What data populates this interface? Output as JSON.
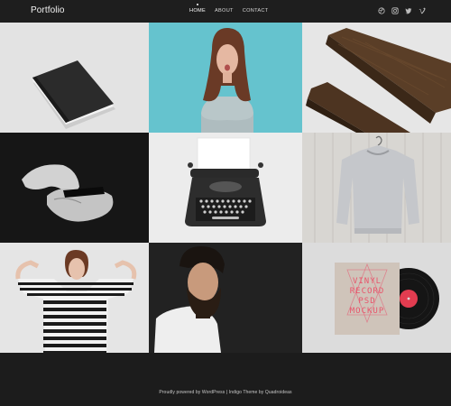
{
  "site": {
    "title": "Portfolio"
  },
  "nav": {
    "items": [
      {
        "label": "HOME",
        "active": true
      },
      {
        "label": "ABOUT",
        "active": false
      },
      {
        "label": "CONTACT",
        "active": false
      }
    ]
  },
  "social": {
    "icons": [
      "dribbble-icon",
      "instagram-icon",
      "twitter-icon",
      "vimeo-icon"
    ]
  },
  "portfolio": {
    "items": [
      {
        "name": "black-notebook",
        "background": "#e3e3e3"
      },
      {
        "name": "woman-on-blue",
        "background": "#65c3ce"
      },
      {
        "name": "wood-boards",
        "background": "#e6e6e6"
      },
      {
        "name": "hands-phone",
        "background": "#161616"
      },
      {
        "name": "typewriter",
        "background": "#ececec"
      },
      {
        "name": "grey-sweater",
        "background": "#d8d6d2"
      },
      {
        "name": "woman-striped-shirt",
        "background": "#e5e5e5"
      },
      {
        "name": "bearded-man",
        "background": "#222222"
      },
      {
        "name": "vinyl-record-mockup",
        "background": "#dcdcdc"
      }
    ]
  },
  "vinyl": {
    "line1": "VINYL",
    "line2": "RECORD",
    "line3": "PSD",
    "line4": "MOCKUP"
  },
  "footer": {
    "text": "Proudly powered by WordPress  |  Indigo Theme by Quadroideas"
  }
}
